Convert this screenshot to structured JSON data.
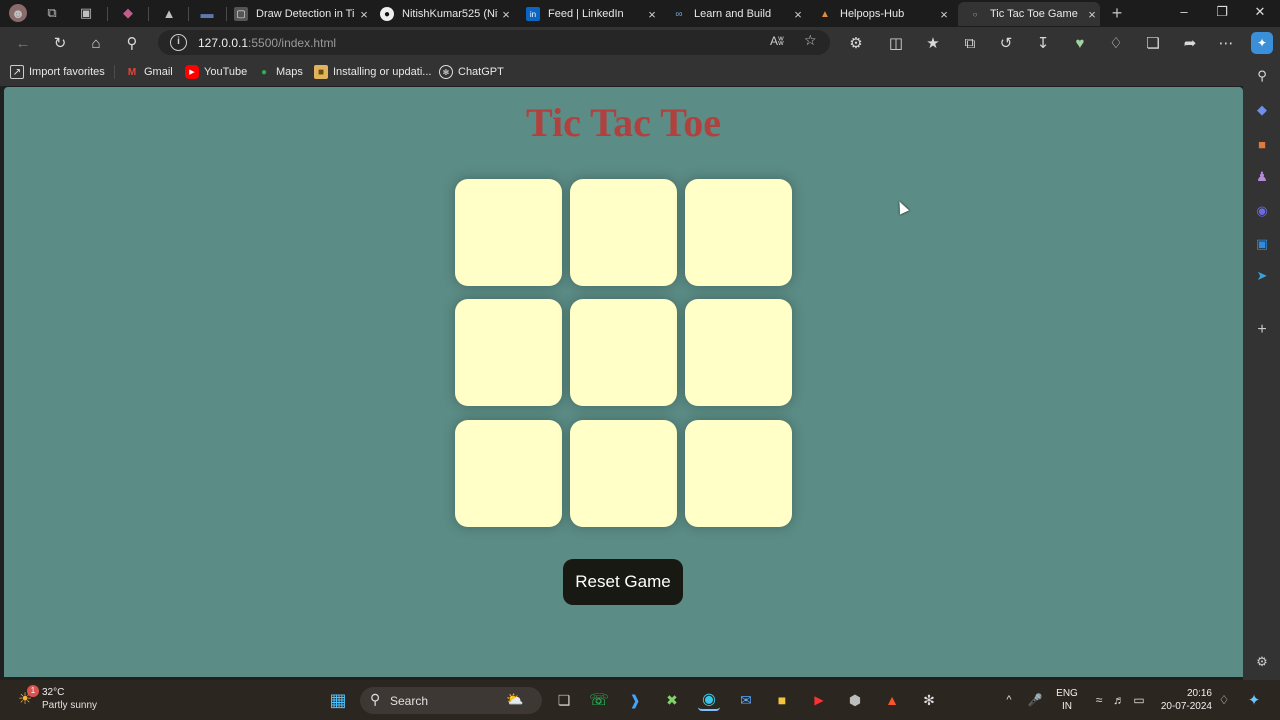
{
  "browser": {
    "tabs": [
      {
        "title": "Draw Detection in Ti",
        "favicon": "page-icon"
      },
      {
        "title": "NitishKumar525 (Nit",
        "favicon": "github-icon"
      },
      {
        "title": "Feed | LinkedIn",
        "favicon": "linkedin-icon"
      },
      {
        "title": "Learn and Build",
        "favicon": "learn-icon"
      },
      {
        "title": "Helpops-Hub",
        "favicon": "helpops-icon"
      },
      {
        "title": "Tic Tac Toe Game",
        "favicon": "page-icon",
        "active": true
      }
    ],
    "tab_close_glyph": "×",
    "new_tab_glyph": "+",
    "address": {
      "host": "127.0.0.1",
      "path": ":5500/index.html",
      "read_aloud": "Aʬ"
    },
    "favorites": [
      {
        "label": "Import favorites",
        "icon": "import-icon"
      },
      {
        "label": "Gmail",
        "icon": "gmail-icon"
      },
      {
        "label": "YouTube",
        "icon": "youtube-icon"
      },
      {
        "label": "Maps",
        "icon": "maps-icon"
      },
      {
        "label": "Installing or updati...",
        "icon": "folder-icon"
      },
      {
        "label": "ChatGPT",
        "icon": "chatgpt-icon"
      }
    ]
  },
  "game": {
    "title": "Tic Tac Toe",
    "board": [
      "",
      "",
      "",
      "",
      "",
      "",
      "",
      "",
      ""
    ],
    "reset_label": "Reset Game",
    "colors": {
      "background": "#5b8c85",
      "cell": "#ffffc7",
      "title": "#b0413e",
      "button": "#191913"
    }
  },
  "taskbar": {
    "weather": {
      "temp": "32°C",
      "desc": "Partly sunny"
    },
    "search_label": "Search",
    "language": {
      "line1": "ENG",
      "line2": "IN"
    },
    "clock": {
      "time": "20:16",
      "date": "20-07-2024"
    },
    "weather_badge": "1"
  }
}
